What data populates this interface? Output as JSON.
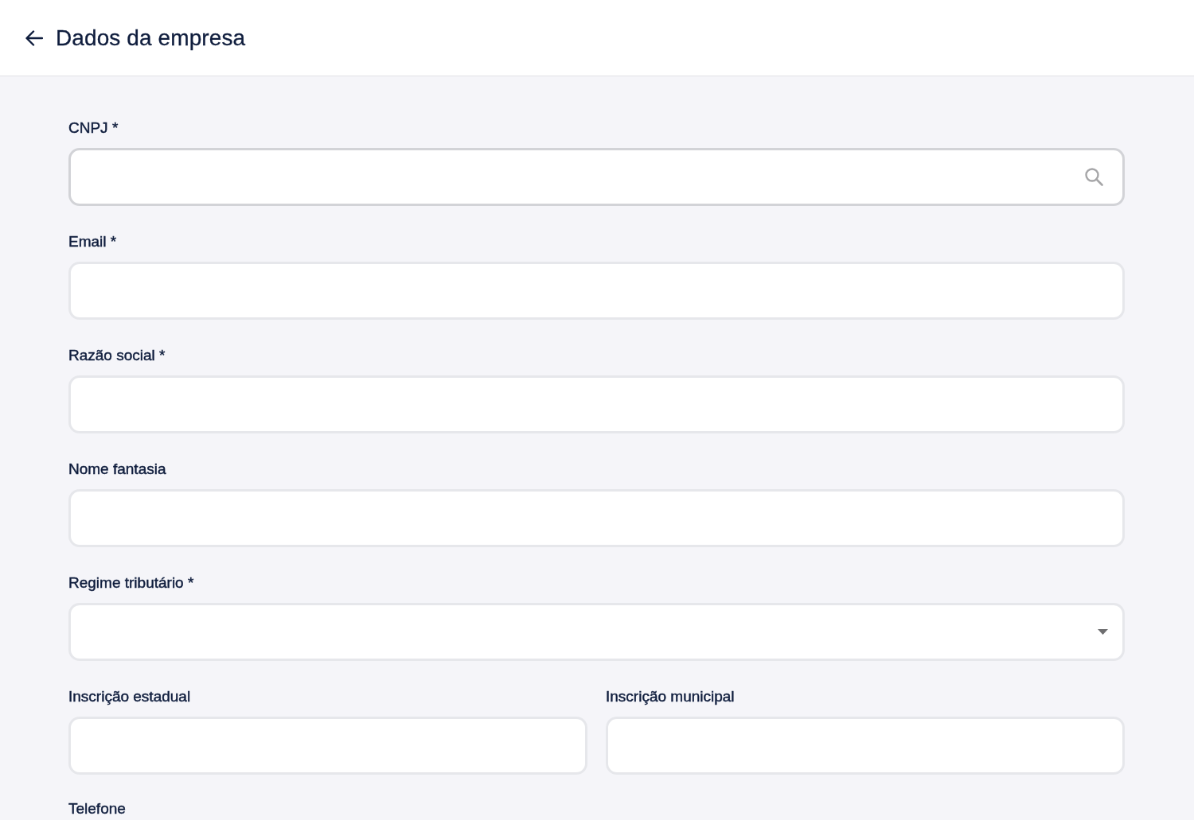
{
  "header": {
    "title": "Dados da empresa"
  },
  "form": {
    "rows": [
      {
        "fields": [
          {
            "label": "CNPJ *",
            "kind": "search",
            "focused": true
          }
        ]
      },
      {
        "fields": [
          {
            "label": "Email *",
            "kind": "text",
            "focused": false
          }
        ]
      },
      {
        "fields": [
          {
            "label": "Razão social *",
            "kind": "text",
            "focused": false
          }
        ]
      },
      {
        "fields": [
          {
            "label": "Nome fantasia",
            "kind": "text",
            "focused": false
          }
        ]
      },
      {
        "fields": [
          {
            "label": "Regime tributário *",
            "kind": "select",
            "focused": false
          }
        ]
      },
      {
        "fields": [
          {
            "label": "Inscrição estadual",
            "kind": "text",
            "focused": false
          },
          {
            "label": "Inscrição municipal",
            "kind": "text",
            "focused": false
          }
        ]
      }
    ],
    "partial_label": "Telefone"
  }
}
